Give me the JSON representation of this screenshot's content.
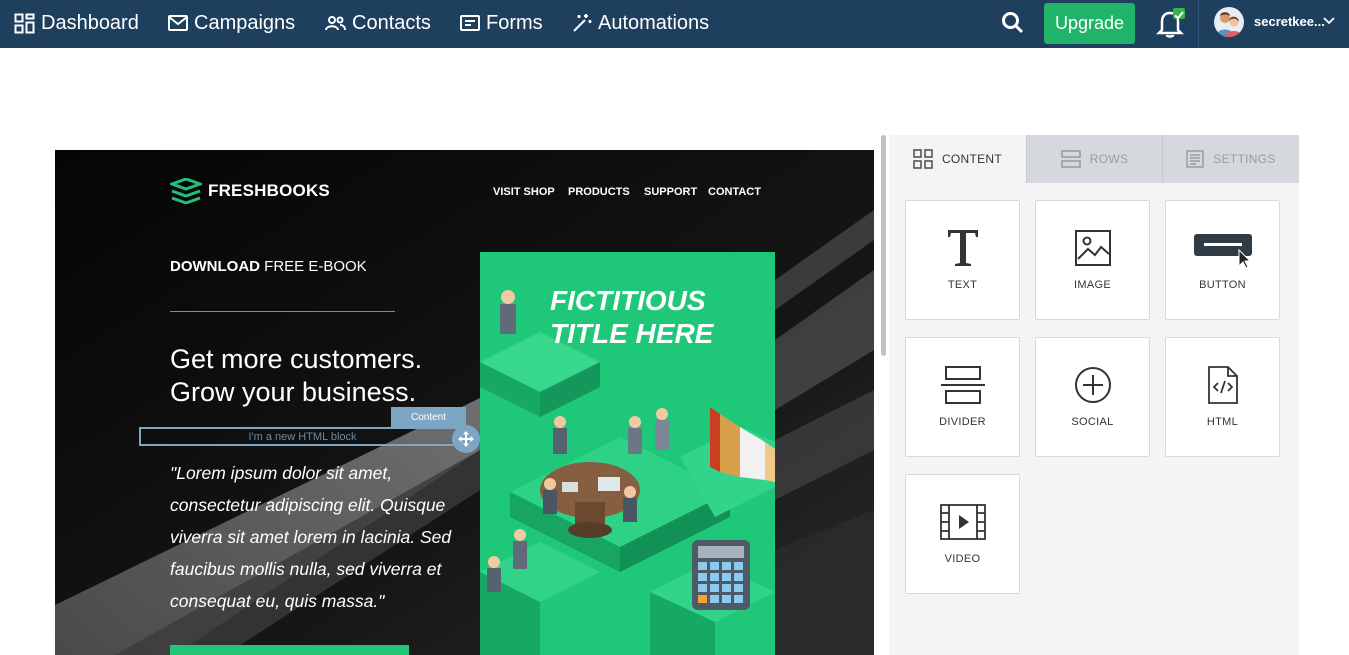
{
  "nav": {
    "items": [
      {
        "label": "Dashboard",
        "icon": "dashboard-icon"
      },
      {
        "label": "Campaigns",
        "icon": "envelope-icon"
      },
      {
        "label": "Contacts",
        "icon": "users-icon"
      },
      {
        "label": "Forms",
        "icon": "form-icon"
      },
      {
        "label": "Automations",
        "icon": "magic-wand-icon"
      }
    ],
    "upgrade_label": "Upgrade",
    "user_name": "secretkee...",
    "colors": {
      "bar": "#1f3f5e",
      "upgrade": "#20b36a",
      "badge": "#37b34a"
    }
  },
  "email": {
    "logo_text": "FRESHBOOKS",
    "menu": [
      "VISIT SHOP",
      "PRODUCTS",
      "SUPPORT",
      "CONTACT"
    ],
    "ebook_bold": "DOWNLOAD",
    "ebook_rest": " FREE E-BOOK",
    "headline_line1": "Get more customers.",
    "headline_line2": "Grow your business.",
    "content_tab": "Content",
    "html_block_placeholder": "I'm a new HTML block",
    "quote": "\"Lorem ipsum dolor sit amet, consectetur adipiscing elit. Quisque viverra sit amet lorem in lacinia. Sed faucibus mollis nulla, sed viverra et consequat eu,  quis massa.\"",
    "book_title_line1": "FICTITIOUS",
    "book_title_line2": "TITLE HERE",
    "colors": {
      "accent": "#20c57a",
      "selection": "#7da6c4"
    }
  },
  "panel": {
    "tabs": [
      {
        "label": "CONTENT",
        "icon": "grid-icon",
        "active": true
      },
      {
        "label": "ROWS",
        "icon": "rows-icon",
        "active": false
      },
      {
        "label": "SETTINGS",
        "icon": "settings-list-icon",
        "active": false
      }
    ],
    "blocks": [
      {
        "label": "TEXT",
        "icon": "text-icon"
      },
      {
        "label": "IMAGE",
        "icon": "image-icon"
      },
      {
        "label": "BUTTON",
        "icon": "button-icon"
      },
      {
        "label": "DIVIDER",
        "icon": "divider-icon"
      },
      {
        "label": "SOCIAL",
        "icon": "social-plus-icon"
      },
      {
        "label": "HTML",
        "icon": "html-file-icon"
      },
      {
        "label": "VIDEO",
        "icon": "video-film-icon"
      }
    ]
  }
}
